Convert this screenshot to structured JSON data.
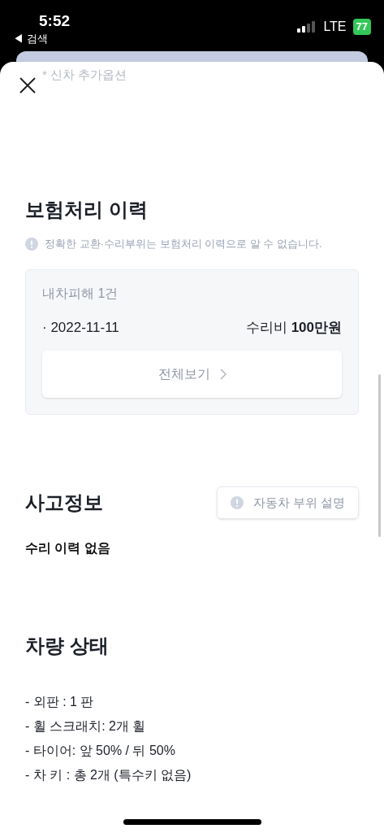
{
  "status_bar": {
    "time": "5:52",
    "back_label": "◀ 검색",
    "network": "LTE",
    "battery": "77"
  },
  "faded_text": "* 신차 추가옵션",
  "insurance": {
    "title": "보험처리 이력",
    "notice": "정확한 교환·수리부위는 보험처리 이력으로 알 수 없습니다.",
    "card": {
      "label": "내차피해 1건",
      "records": [
        {
          "date": "· 2022-11-11",
          "cost_label": "수리비",
          "cost": "100만원"
        }
      ],
      "button": "전체보기"
    }
  },
  "accident": {
    "title": "사고정보",
    "button": "자동차 부위 설명",
    "text": "수리 이력 없음"
  },
  "condition": {
    "title": "차량 상태",
    "lines": [
      "- 외판 : 1 판",
      "- 휠 스크래치: 2개 휠",
      "- 타이어: 앞 50% / 뒤 50%",
      "- 차 키 : 총 2개 (특수키 없음)"
    ]
  }
}
